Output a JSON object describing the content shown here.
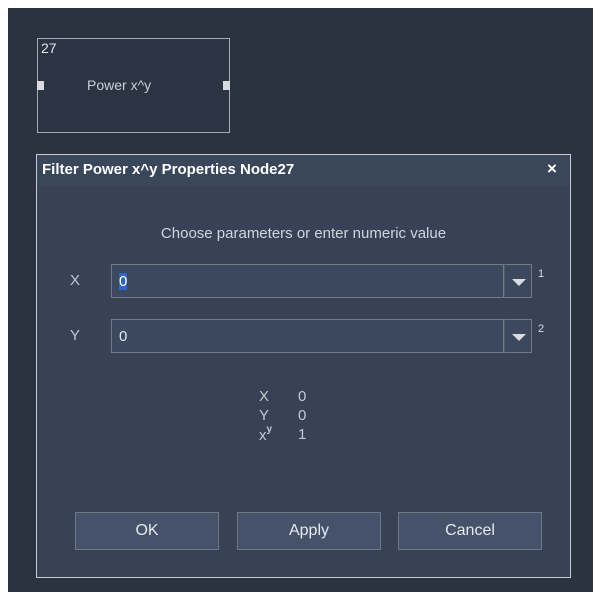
{
  "node": {
    "id": "27",
    "label": "Power x^y"
  },
  "dialog": {
    "title": "Filter Power x^y Properties Node27",
    "close_glyph": "×",
    "instruction": "Choose parameters or enter numeric value",
    "params": [
      {
        "label": "X",
        "value": "0",
        "index": "1"
      },
      {
        "label": "Y",
        "value": "0",
        "index": "2"
      }
    ],
    "results": [
      {
        "label": "X",
        "value": "0"
      },
      {
        "label": "Y",
        "value": "0"
      },
      {
        "label": "x",
        "sup": "y",
        "value": "1"
      }
    ],
    "buttons": {
      "ok": "OK",
      "apply": "Apply",
      "cancel": "Cancel"
    }
  },
  "colors": {
    "canvas_bg": "#2b3341",
    "dialog_bg": "#374257",
    "selection": "#2f64c8"
  },
  "icons": {
    "close": "close-icon",
    "dropdown": "chevron-down-icon"
  }
}
